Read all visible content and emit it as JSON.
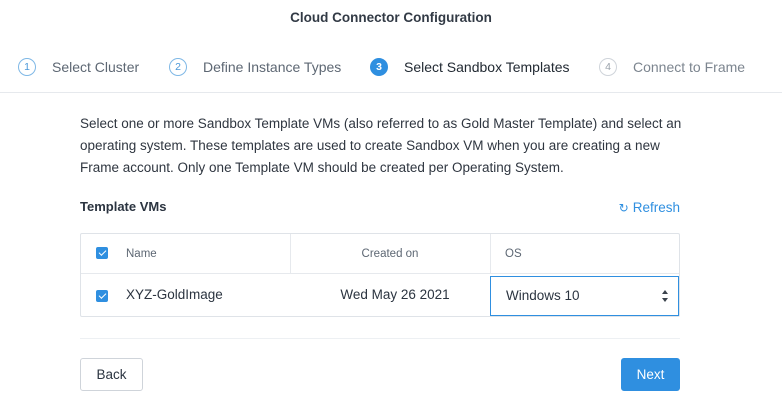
{
  "header": {
    "title": "Cloud Connector Configuration"
  },
  "steps": [
    {
      "number": "1",
      "label": "Select Cluster"
    },
    {
      "number": "2",
      "label": "Define Instance Types"
    },
    {
      "number": "3",
      "label": "Select Sandbox Templates"
    },
    {
      "number": "4",
      "label": "Connect to Frame"
    }
  ],
  "description": "Select one or more Sandbox Template VMs (also referred to as Gold Master Template) and select an operating system. These templates are used to create Sandbox VM when you are creating a new Frame account. Only one Template VM should be created per Operating System.",
  "templates": {
    "title": "Template VMs",
    "refresh_icon": "↻",
    "refresh_label": "Refresh",
    "columns": {
      "name": "Name",
      "created": "Created on",
      "os": "OS"
    },
    "rows": [
      {
        "name": "XYZ-GoldImage",
        "created": "Wed May 26 2021",
        "os": "Windows 10",
        "checked": true
      }
    ]
  },
  "buttons": {
    "back": "Back",
    "next": "Next"
  },
  "colors": {
    "accent": "#2f8fe0"
  }
}
